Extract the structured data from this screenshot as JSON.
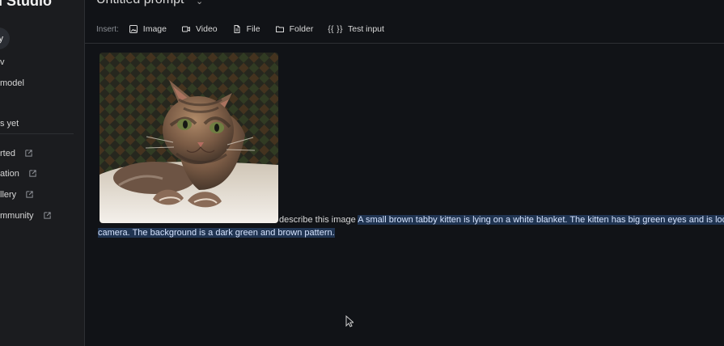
{
  "app": {
    "title": "Google AI Studio",
    "visible_brand_fragment": "I Studio"
  },
  "sidebar": {
    "items": [
      {
        "label": "y",
        "selected": true
      },
      {
        "label": "v"
      },
      {
        "label": "model"
      },
      {
        "label": "s yet"
      },
      {
        "label": "rted",
        "external": true,
        "icon": "external-link-icon"
      },
      {
        "label": "ation",
        "external": true,
        "icon": "external-link-icon"
      },
      {
        "label": "llery",
        "external": true,
        "icon": "external-link-icon"
      },
      {
        "label": "mmunity",
        "external": true,
        "icon": "external-link-icon"
      }
    ]
  },
  "header": {
    "title": "Untitled prompt",
    "caret_icon": "chevron-down-icon"
  },
  "toolbar": {
    "insert_label": "Insert:",
    "buttons": [
      {
        "label": "Image",
        "icon": "image-icon"
      },
      {
        "label": "Video",
        "icon": "video-icon"
      },
      {
        "label": "File",
        "icon": "file-icon"
      },
      {
        "label": "Folder",
        "icon": "folder-icon"
      },
      {
        "label": "Test input",
        "icon": "braces-icon",
        "icon_text": "{{ }}"
      }
    ]
  },
  "prompt": {
    "user_text": "describe this image",
    "generated_first_line": "A small brown tabby kitten is lying on a white blanket. The kitten has big green eyes and is look",
    "generated_second_line": "camera. The background is a dark green and brown pattern."
  },
  "colors": {
    "background": "#111317",
    "sidebar": "#1b1c1f",
    "selection": "#203451",
    "text": "#e3e3e3"
  }
}
